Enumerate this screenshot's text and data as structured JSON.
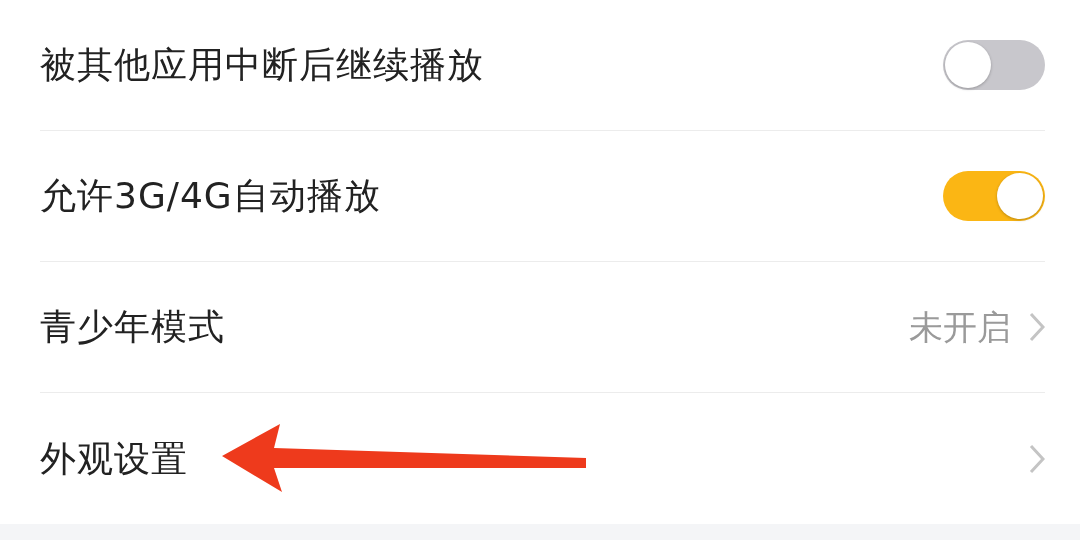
{
  "rows": [
    {
      "kind": "toggle",
      "label": "被其他应用中断后继续播放",
      "on": false
    },
    {
      "kind": "toggle",
      "label": "允许3G/4G自动播放",
      "on": true
    },
    {
      "kind": "link",
      "label": "青少年模式",
      "value": "未开启"
    },
    {
      "kind": "link",
      "label": "外观设置"
    }
  ]
}
